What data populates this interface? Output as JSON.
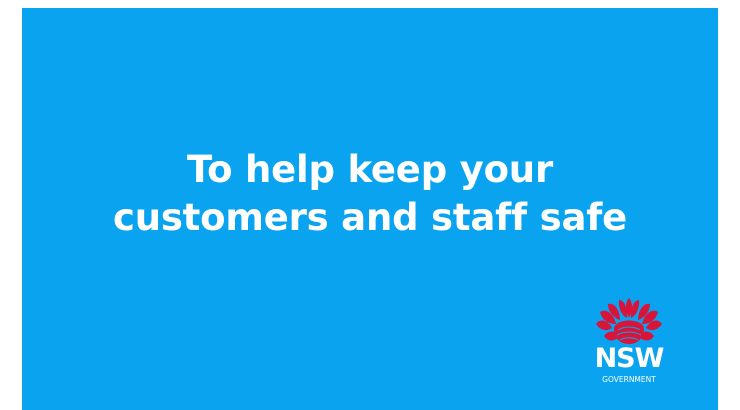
{
  "slide": {
    "background_color": "#0aa3f0",
    "text_color": "#ffffff",
    "headline_line_1": "To help keep your",
    "headline_line_2": "customers and staff safe"
  },
  "logo": {
    "icon": "waratah-flower",
    "flower_color": "#d7153a",
    "wordmark": "NSW",
    "subtext": "GOVERNMENT"
  }
}
